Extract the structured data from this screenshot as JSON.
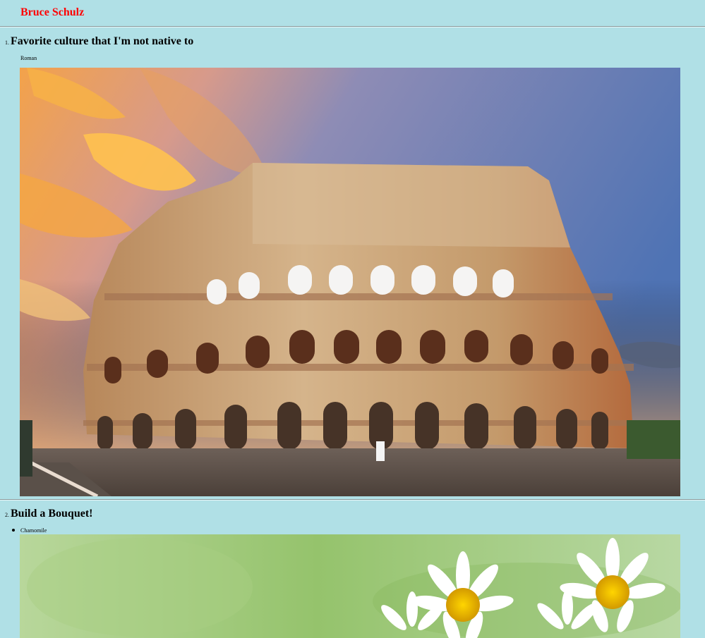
{
  "header": {
    "name": "Bruce Schulz",
    "name_color": "#ff0000"
  },
  "page": {
    "background": "#b0e0e6"
  },
  "sections": [
    {
      "number": "1.",
      "title": "Favorite culture that I'm not native to",
      "caption": "Roman",
      "image": "colosseum-photo"
    },
    {
      "number": "2.",
      "title": "Build a Bouquet!",
      "items": [
        {
          "label": "Chamomile",
          "image": "chamomile-photo"
        }
      ]
    }
  ]
}
